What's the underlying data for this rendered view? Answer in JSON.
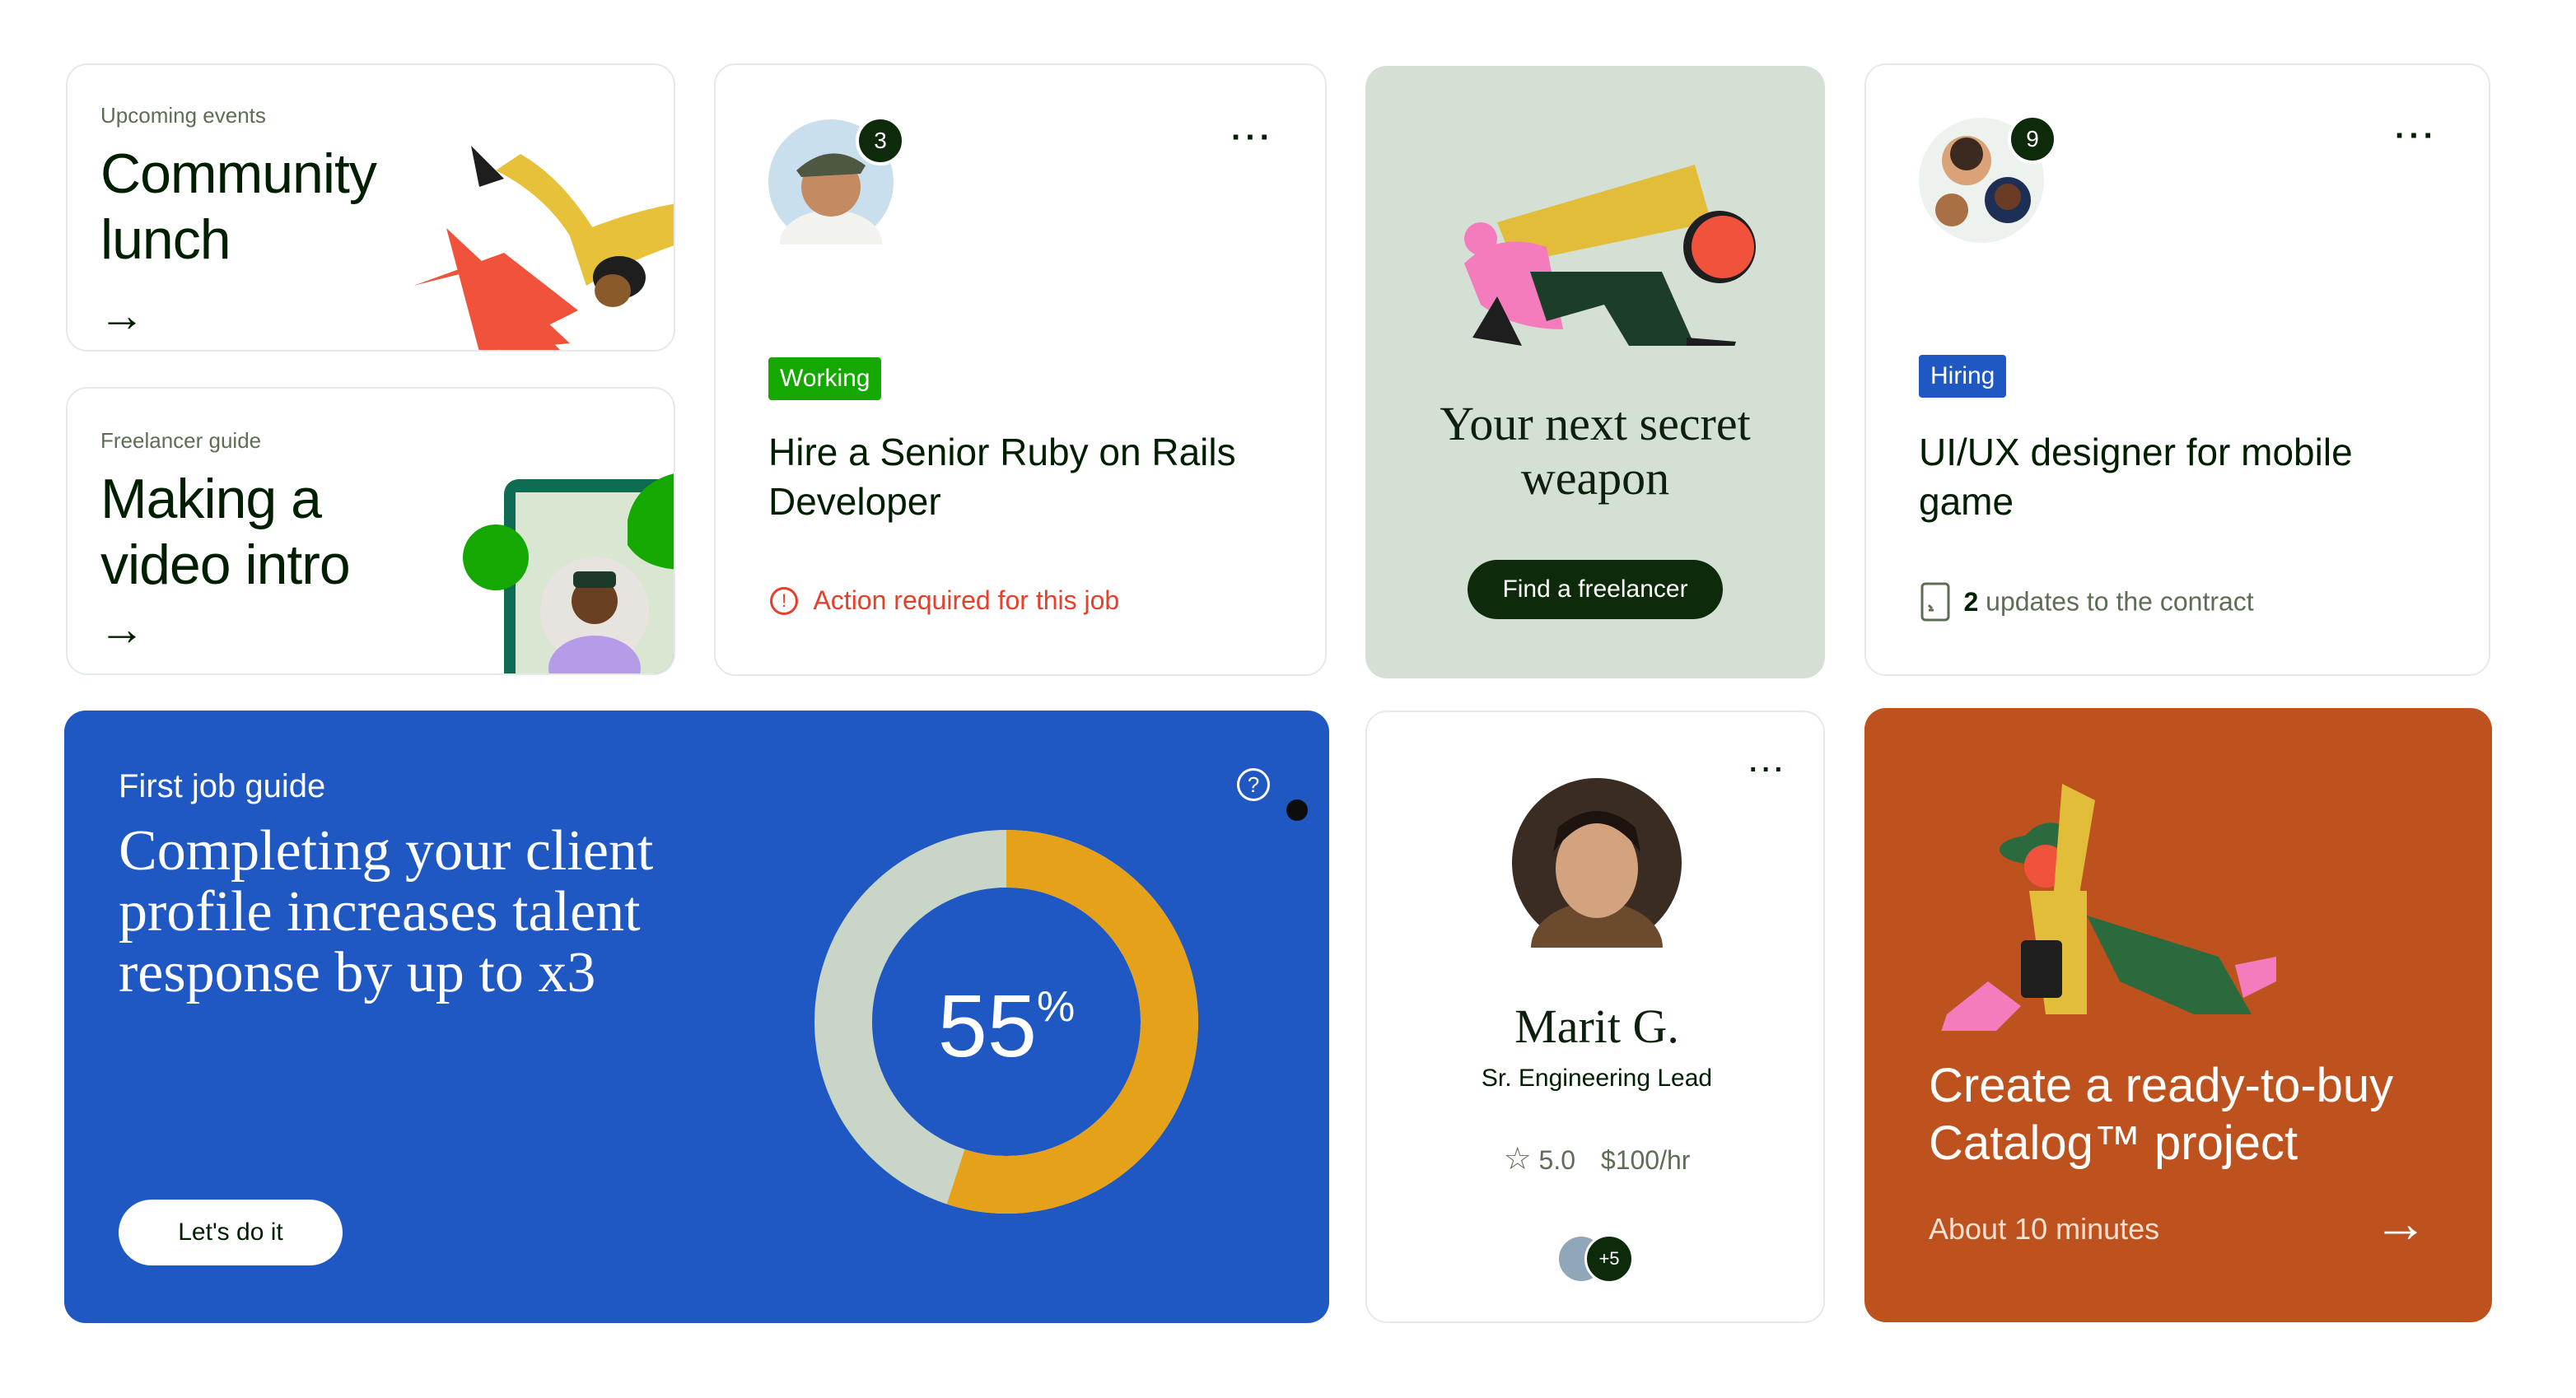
{
  "community": {
    "eyebrow": "Upcoming events",
    "title_l1": "Community",
    "title_l2": "lunch",
    "arrow": "→"
  },
  "guide": {
    "eyebrow": "Freelancer guide",
    "title_l1": "Making a",
    "title_l2": "video intro",
    "arrow": "→"
  },
  "job1": {
    "badge_count": "3",
    "menu": "···",
    "status": "Working",
    "title_l1": "Hire a Senior Ruby on Rails",
    "title_l2": "Developer",
    "alert_icon": "!",
    "alert": "Action required for this job",
    "colors": {
      "status": "#14a800",
      "alert": "#e4402b"
    }
  },
  "promo": {
    "title_l1": "Your next secret",
    "title_l2": "weapon",
    "button": "Find a freelancer",
    "bg": "#d5e0d5"
  },
  "job2": {
    "badge_count": "9",
    "menu": "···",
    "status": "Hiring",
    "title_l1": "UI/UX designer for mobile",
    "title_l2": "game",
    "update_count": "2",
    "update_text": " updates to the contract",
    "colors": {
      "status": "#1f57c3"
    }
  },
  "first_job": {
    "eyebrow": "First job guide",
    "title_l1": "Completing your client",
    "title_l2": "profile increases talent",
    "title_l3": "response by up to x3",
    "help_icon": "?",
    "button": "Let's do it",
    "progress_value": "55",
    "progress_unit": "%",
    "progress_fraction": 0.55,
    "bg": "#1f57c3"
  },
  "talent": {
    "menu": "···",
    "name": "Marit G.",
    "role": "Sr. Engineering Lead",
    "star": "☆",
    "rating": "5.0",
    "rate": "$100/hr",
    "more": "+5"
  },
  "catalog": {
    "title_l1": "Create a ready-to-buy",
    "title_l2": "Catalog™ project",
    "duration": "About 10 minutes",
    "arrow": "→",
    "bg": "#be521e"
  }
}
